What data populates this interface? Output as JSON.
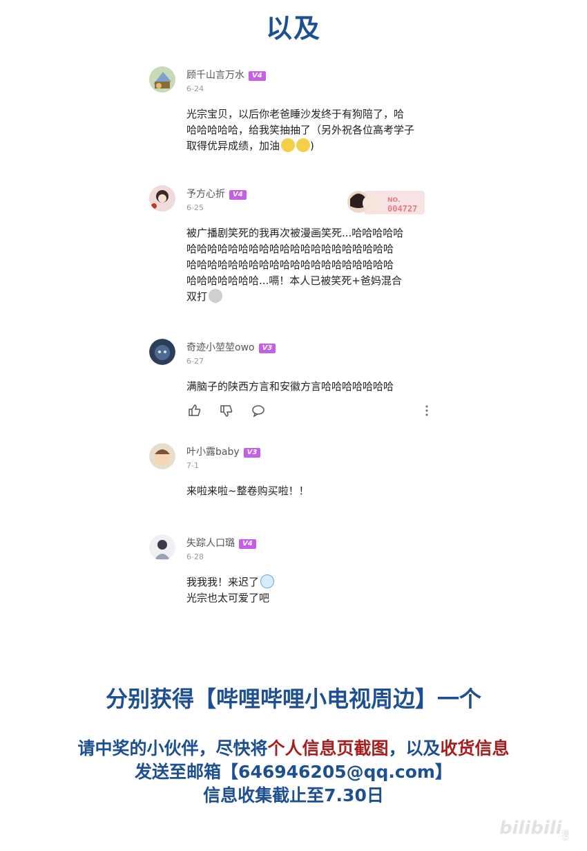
{
  "header": {
    "title": "以及"
  },
  "comments": [
    {
      "username": "顾千山言万水",
      "level": "V4",
      "date": "6-24",
      "lines": [
        "光宗宝贝，以后你老爸睡沙发终于有狗陪了，哈",
        "哈哈哈哈哈，给我笑抽抽了（另外祝各位高考学子",
        "取得优异成绩，加油"
      ]
    },
    {
      "username": "予方心折",
      "level": "V4",
      "date": "6-25",
      "fan_badge": {
        "prefix": "NO.",
        "number": "004727"
      },
      "lines": [
        "被广播剧笑死的我再次被漫画笑死...哈哈哈哈哈",
        "哈哈哈哈哈哈哈哈哈哈哈哈哈哈哈哈哈哈哈哈",
        "哈哈哈哈哈哈哈哈哈哈哈哈哈哈哈哈哈哈哈哈",
        "哈哈哈哈哈哈哈...嗝！本人已被笑死+爸妈混合",
        "双打"
      ]
    },
    {
      "username": "奇迹小堃堃owo",
      "level": "V3",
      "date": "6-27",
      "lines": [
        "满脑子的陕西方言和安徽方言哈哈哈哈哈哈哈"
      ]
    },
    {
      "username": "叶小露baby",
      "level": "V3",
      "date": "7-1",
      "lines": [
        "来啦来啦~整卷购买啦！！"
      ]
    },
    {
      "username": "失踪人口璐",
      "level": "V4",
      "date": "6-28",
      "lines": [
        "我我我！来迟了",
        "光宗也太可爱了吧"
      ]
    }
  ],
  "actions": [
    "like-icon",
    "dislike-icon",
    "reply-icon",
    "more-icon"
  ],
  "prize": {
    "text": "分别获得【哔哩哔哩小电视周边】一个"
  },
  "notice": {
    "line1_a": "请中奖的小伙伴，尽快将",
    "line1_b": "个人信息页截图",
    "line1_c": "，以及",
    "line1_d": "收货信息",
    "line2": "发送至邮箱【646946205@qq.com】",
    "line3": "信息收集截止至7.30日"
  },
  "watermark": {
    "text": "bilibili",
    "sub": "漫画"
  },
  "colors": {
    "heading": "#1d4f93",
    "highlight": "#a61f1f",
    "level_badge": "#c65fe8"
  }
}
